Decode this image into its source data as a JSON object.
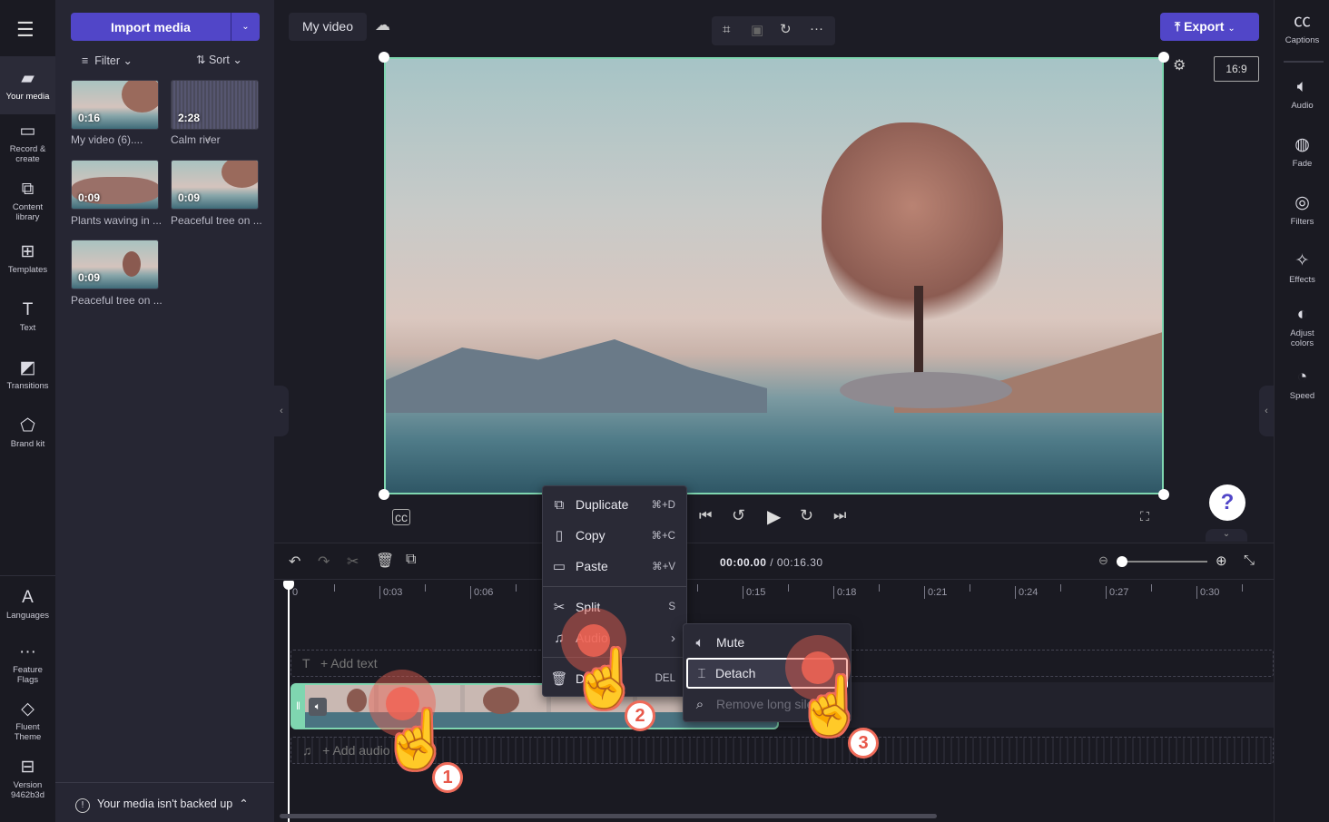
{
  "nav": {
    "items": [
      {
        "label": "Your media",
        "icon": "folder-icon"
      },
      {
        "label": "Record & create",
        "icon": "camera-icon"
      },
      {
        "label": "Content library",
        "icon": "content-library-icon"
      },
      {
        "label": "Templates",
        "icon": "templates-icon"
      },
      {
        "label": "Text",
        "icon": "text-icon"
      },
      {
        "label": "Transitions",
        "icon": "transitions-icon"
      },
      {
        "label": "Brand kit",
        "icon": "brand-kit-icon"
      }
    ],
    "bottom": [
      {
        "label": "Languages",
        "icon": "languages-icon"
      },
      {
        "label": "Feature Flags",
        "icon": "more-icon"
      },
      {
        "label": "Fluent Theme",
        "icon": "paint-bucket-icon"
      },
      {
        "label": "Version 9462b3d",
        "icon": "archive-icon"
      }
    ]
  },
  "media": {
    "import_label": "Import media",
    "filter_label": "Filter",
    "sort_label": "Sort",
    "items": [
      {
        "duration": "0:16",
        "title": "My video (6)....",
        "added": true
      },
      {
        "duration": "2:28",
        "title": "Calm river",
        "type": "audio"
      },
      {
        "duration": "0:09",
        "title": "Plants waving in ..."
      },
      {
        "duration": "0:09",
        "title": "Peaceful tree on ..."
      },
      {
        "duration": "0:09",
        "title": "Peaceful tree on ..."
      }
    ],
    "backup_notice": "Your media isn't backed up"
  },
  "header": {
    "project_title": "My video",
    "export_label": "Export",
    "aspect_ratio": "16:9"
  },
  "right_panel": {
    "items": [
      {
        "label": "Captions",
        "icon": "captions-icon"
      },
      {
        "label": "Audio",
        "icon": "speaker-icon"
      },
      {
        "label": "Fade",
        "icon": "fade-icon"
      },
      {
        "label": "Filters",
        "icon": "filters-icon"
      },
      {
        "label": "Effects",
        "icon": "magic-wand-icon"
      },
      {
        "label": "Adjust colors",
        "icon": "contrast-icon"
      },
      {
        "label": "Speed",
        "icon": "speedometer-icon"
      }
    ]
  },
  "player": {
    "current_time": "00:00.00",
    "total_time": "/ 00:16.30",
    "help": "?"
  },
  "timeline": {
    "ticks": [
      "0",
      "0:03",
      "0:06",
      "0:09",
      "0:12",
      "0:15",
      "0:18",
      "0:21",
      "0:24",
      "0:27",
      "0:30"
    ],
    "add_text": "+ Add text",
    "add_audio": "+ Add audio"
  },
  "context_menu": {
    "items": [
      {
        "label": "Duplicate",
        "shortcut": "⌘+D",
        "icon": "duplicate-icon"
      },
      {
        "label": "Copy",
        "shortcut": "⌘+C",
        "icon": "copy-icon"
      },
      {
        "label": "Paste",
        "shortcut": "⌘+V",
        "icon": "paste-icon"
      },
      {
        "label": "Split",
        "shortcut": "S",
        "icon": "scissors-icon"
      },
      {
        "label": "Audio",
        "shortcut": "",
        "icon": "music-note-icon"
      },
      {
        "label": "Delete",
        "shortcut": "DEL",
        "icon": "trash-icon"
      }
    ],
    "submenu": [
      {
        "label": "Mute",
        "icon": "speaker-icon"
      },
      {
        "label": "Detach",
        "icon": "detach-icon",
        "highlighted": true
      },
      {
        "label": "Remove long silences",
        "icon": "search-sparkle-icon",
        "disabled": true
      }
    ]
  },
  "steps": [
    "1",
    "2",
    "3"
  ],
  "colors": {
    "accent": "#5146c8",
    "selection": "#7fd6b0",
    "tap": "#ef6b5a"
  }
}
